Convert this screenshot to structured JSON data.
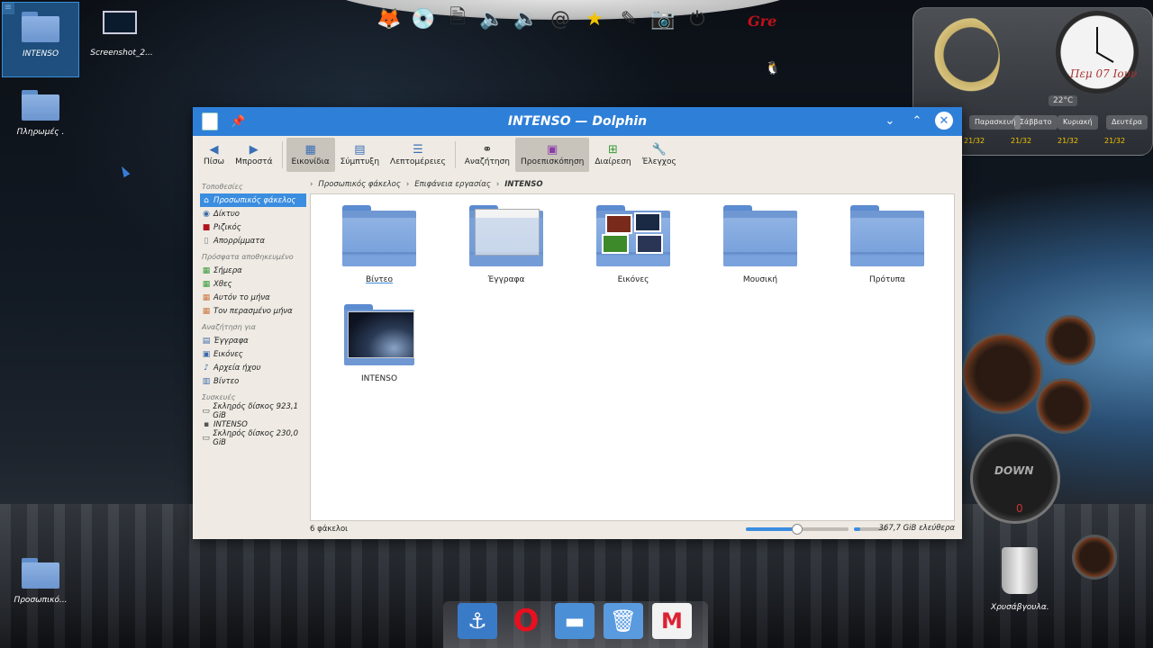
{
  "desktop": {
    "icons": [
      {
        "label": "INTENSO"
      },
      {
        "label": "Screenshot_2..."
      },
      {
        "label": "Πληρωμές ."
      },
      {
        "label": "Προσωπικό..."
      },
      {
        "label": "Χρυσάβγουλα."
      }
    ],
    "top_dock_text": "Gre"
  },
  "widgets": {
    "date": "Πεμ 07 Ιουν",
    "temp": "22°C",
    "days": [
      "Παρασκευή",
      "Σάββατο",
      "Κυριακή",
      "Δευτέρα"
    ],
    "day_dates": [
      "21/32",
      "21/32",
      "21/32",
      "21/32"
    ],
    "gauge_down": "DOWN",
    "gauge_zero": "0"
  },
  "window": {
    "title": "INTENSO — Dolphin",
    "toolbar": [
      {
        "label": "Πίσω",
        "icon": "arrow-left-icon"
      },
      {
        "label": "Μπροστά",
        "icon": "arrow-right-icon"
      },
      {
        "label": "Εικονίδια",
        "icon": "icons-view-icon",
        "active": true
      },
      {
        "label": "Σύμπτυξη",
        "icon": "compact-view-icon"
      },
      {
        "label": "Λεπτομέρειες",
        "icon": "details-view-icon"
      },
      {
        "label": "Αναζήτηση",
        "icon": "binoculars-icon"
      },
      {
        "label": "Προεπισκόπηση",
        "icon": "preview-icon",
        "active": true
      },
      {
        "label": "Διαίρεση",
        "icon": "split-icon"
      },
      {
        "label": "Έλεγχος",
        "icon": "wrench-icon"
      }
    ],
    "places": {
      "headers": [
        "Τοποθεσίες",
        "Πρόσφατα αποθηκευμένο",
        "Αναζήτηση για",
        "Συσκευές"
      ],
      "locations": [
        "Προσωπικός φάκελος",
        "Δίκτυο",
        "Ριζικός",
        "Απορρίμματα"
      ],
      "recent": [
        "Σήμερα",
        "Χθες",
        "Αυτόν το μήνα",
        "Τον περασμένο μήνα"
      ],
      "search": [
        "Έγγραφα",
        "Εικόνες",
        "Αρχεία ήχου",
        "Βίντεο"
      ],
      "devices": [
        "Σκληρός δίσκος 923,1 GiB",
        "INTENSO",
        "Σκληρός δίσκος 230,0 GiB"
      ]
    },
    "breadcrumb": [
      "Προσωπικός φάκελος",
      "Επιφάνεια εργασίας",
      "INTENSO"
    ],
    "files": [
      {
        "name": "Βίντεο"
      },
      {
        "name": "Έγγραφα"
      },
      {
        "name": "Εικόνες"
      },
      {
        "name": "Μουσική"
      },
      {
        "name": "Πρότυπα"
      },
      {
        "name": "INTENSO"
      }
    ],
    "status": {
      "count": "6 φάκελοι",
      "free": "367,7 GiB ελεύθερα",
      "zoom_fraction": 0.5,
      "used_fraction": 0.2
    }
  },
  "colors": {
    "titlebar": "#2e7fd8",
    "selection": "#3b8de0",
    "window_bg": "#efebe4"
  }
}
